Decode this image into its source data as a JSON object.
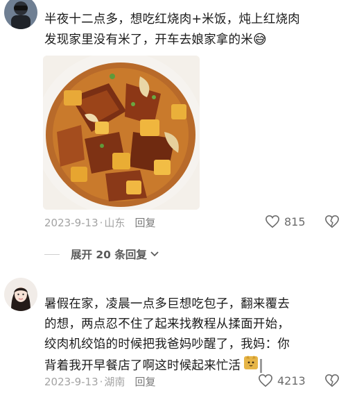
{
  "comments": [
    {
      "text_lines": [
        "半夜十二点多，想吃红烧肉+米饭，炖上红烧肉",
        "发现家里没有米了，开车去娘家拿的米"
      ],
      "emoji": "😅",
      "image_alt": "红烧肉炖土豆",
      "date": "2023-9-13",
      "location": "山东",
      "reply_label": "回复",
      "likes": "815",
      "expand_replies": "展开 20 条回复"
    },
    {
      "text_lines": [
        "暑假在家，凌晨一点多巨想吃包子，翻来覆去",
        "的想，两点忍不住了起来找教程从揉面开始，",
        "绞肉机绞馅的时候把我爸妈吵醒了，我妈：你",
        "背着我开早餐店了啊这时候起来忙活"
      ],
      "date": "2023-9-13",
      "location": "湖南",
      "reply_label": "回复",
      "likes": "4213"
    }
  ],
  "icons": {
    "like": "heart-outline-icon",
    "dislike": "broken-heart-icon",
    "expand": "chevron-down-icon",
    "sticker": "cat-sticker-icon"
  },
  "colors": {
    "meta_text": "#a3a3a3",
    "body_text": "#1b1b1b",
    "expand_text": "#5a5a5a"
  }
}
